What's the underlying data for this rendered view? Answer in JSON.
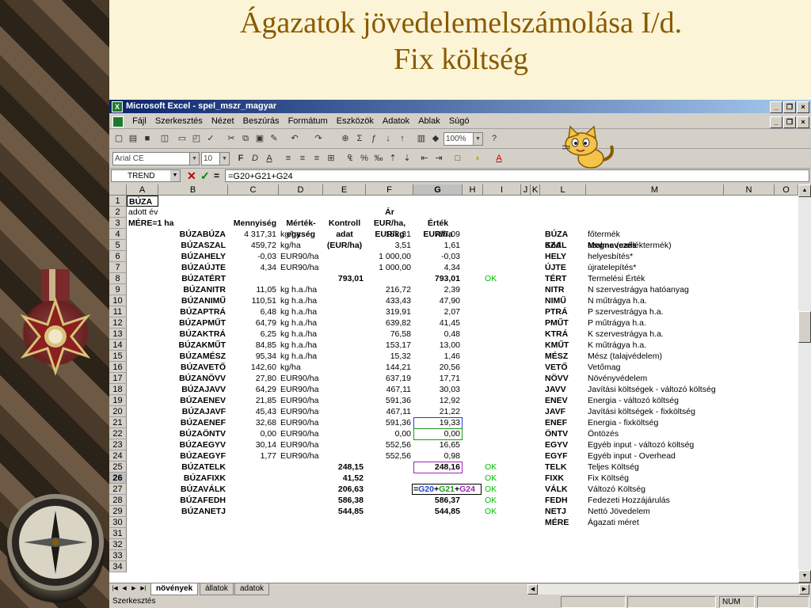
{
  "slide_title_line1": "Ágazatok jövedelemelszámolása I/d.",
  "slide_title_line2": "Fix költség",
  "window": {
    "title": "Microsoft Excel - spel_mszr_magyar",
    "buttons": [
      "_",
      "❐",
      "×"
    ],
    "doc_buttons": [
      "_",
      "❐",
      "×"
    ]
  },
  "menu": [
    "Fájl",
    "Szerkesztés",
    "Nézet",
    "Beszúrás",
    "Formátum",
    "Eszközök",
    "Adatok",
    "Ablak",
    "Súgó"
  ],
  "toolbar": {
    "zoom": "100%",
    "font": "Arial CE",
    "size": "10"
  },
  "formula_bar": {
    "name_box": "TREND",
    "formula": "=G20+G21+G24"
  },
  "columns": [
    "A",
    "B",
    "C",
    "D",
    "E",
    "F",
    "G",
    "H",
    "I",
    "J",
    "K",
    "L",
    "M",
    "N",
    "O"
  ],
  "active_column": "G",
  "rows_numbers": [
    "1",
    "2",
    "3",
    "4",
    "5",
    "6",
    "7",
    "8",
    "9",
    "10",
    "11",
    "12",
    "13",
    "14",
    "15",
    "16",
    "17",
    "18",
    "19",
    "20",
    "21",
    "22",
    "23",
    "24",
    "25",
    "26",
    "27",
    "28",
    "29",
    "30",
    "31",
    "32",
    "33",
    "34"
  ],
  "active_row": "26",
  "header": {
    "a1": "BÚZA",
    "a2": "adott év",
    "a2b": "MÉRE=1 ha",
    "c": "Mennyiség",
    "d1": "Mérték-",
    "d2": "egység",
    "e1": "Kontroll",
    "e2": "adat",
    "e3": "(EUR/ha)",
    "f1": "Ár",
    "f2": "EUR/ha,",
    "f3": "EUR/kg",
    "g1": "Érték",
    "g2": "EUR/ha",
    "l": "Kód",
    "m": "Megnevezés"
  },
  "rows": [
    {
      "b": "BÚZABÚZA",
      "c": "4 317,31",
      "d": "kg/ha",
      "e": "",
      "f": "182,31",
      "g": "787,09",
      "i": "",
      "l": "BÚZA",
      "m": "főtermék"
    },
    {
      "b": "BÚZASZAL",
      "c": "459,72",
      "d": "kg/ha",
      "e": "",
      "f": "3,51",
      "g": "1,61",
      "i": "",
      "l": "SZAL",
      "m": "szalma (melléktermék)"
    },
    {
      "b": "BÚZAHELY",
      "c": "-0,03",
      "d": "EUR90/ha",
      "e": "",
      "f": "1 000,00",
      "g": "-0,03",
      "i": "",
      "l": "HELY",
      "m": "helyesbítés*"
    },
    {
      "b": "BÚZAÚJTE",
      "c": "4,34",
      "d": "EUR90/ha",
      "e": "",
      "f": "1 000,00",
      "g": "4,34",
      "i": "",
      "l": "ÚJTE",
      "m": "újratelepítés*"
    },
    {
      "b": "BÚZATÉRT",
      "c": "",
      "d": "",
      "e": "793,01",
      "f": "",
      "g": "793,01",
      "i": "OK",
      "l": "TÉRT",
      "m": "Termelési Érték",
      "bold": true
    },
    {
      "b": "BÚZANITR",
      "c": "11,05",
      "d": "kg h.a./ha",
      "e": "",
      "f": "216,72",
      "g": "2,39",
      "i": "",
      "l": "NITR",
      "m": "N szervestrágya hatóanyag"
    },
    {
      "b": "BÚZANIMŰ",
      "c": "110,51",
      "d": "kg h.a./ha",
      "e": "",
      "f": "433,43",
      "g": "47,90",
      "i": "",
      "l": "NIMŰ",
      "m": "N műtrágya h.a."
    },
    {
      "b": "BÚZAPTRÁ",
      "c": "6,48",
      "d": "kg h.a./ha",
      "e": "",
      "f": "319,91",
      "g": "2,07",
      "i": "",
      "l": "PTRÁ",
      "m": "P szervestrágya h.a."
    },
    {
      "b": "BÚZAPMŰT",
      "c": "64,79",
      "d": "kg h.a./ha",
      "e": "",
      "f": "639,82",
      "g": "41,45",
      "i": "",
      "l": "PMŰT",
      "m": "P műtrágya h.a."
    },
    {
      "b": "BÚZAKTRÁ",
      "c": "6,25",
      "d": "kg h.a./ha",
      "e": "",
      "f": "76,58",
      "g": "0,48",
      "i": "",
      "l": "KTRÁ",
      "m": "K szervestrágya h.a."
    },
    {
      "b": "BÚZAKMŰT",
      "c": "84,85",
      "d": "kg h.a./ha",
      "e": "",
      "f": "153,17",
      "g": "13,00",
      "i": "",
      "l": "KMŰT",
      "m": "K műtrágya h.a."
    },
    {
      "b": "BÚZAMÉSZ",
      "c": "95,34",
      "d": "kg h.a./ha",
      "e": "",
      "f": "15,32",
      "g": "1,46",
      "i": "",
      "l": "MÉSZ",
      "m": "Mész (talajvédelem)"
    },
    {
      "b": "BÚZAVETŐ",
      "c": "142,60",
      "d": "kg/ha",
      "e": "",
      "f": "144,21",
      "g": "20,56",
      "i": "",
      "l": "VETŐ",
      "m": "Vetőmag"
    },
    {
      "b": "BÚZANÖVV",
      "c": "27,80",
      "d": "EUR90/ha",
      "e": "",
      "f": "637,19",
      "g": "17,71",
      "i": "",
      "l": "NÖVV",
      "m": "Növényvédelem"
    },
    {
      "b": "BÚZAJAVV",
      "c": "64,29",
      "d": "EUR90/ha",
      "e": "",
      "f": "467,11",
      "g": "30,03",
      "i": "",
      "l": "JAVV",
      "m": "Javítási költségek - változó költség"
    },
    {
      "b": "BÚZAENEV",
      "c": "21,85",
      "d": "EUR90/ha",
      "e": "",
      "f": "591,36",
      "g": "12,92",
      "i": "",
      "l": "ENEV",
      "m": "Energia - változó költség"
    },
    {
      "b": "BÚZAJAVF",
      "c": "45,43",
      "d": "EUR90/ha",
      "e": "",
      "f": "467,11",
      "g": "21,22",
      "i": "",
      "l": "JAVF",
      "m": "Javítási költségek - fixköltség"
    },
    {
      "b": "BÚZAENEF",
      "c": "32,68",
      "d": "EUR90/ha",
      "e": "",
      "f": "591,36",
      "g": "19,33",
      "i": "",
      "l": "ENEF",
      "m": "Energia - fixköltség"
    },
    {
      "b": "BÚZAÖNTV",
      "c": "0,00",
      "d": "EUR90/ha",
      "e": "",
      "f": "0,00",
      "g": "0,00",
      "i": "",
      "l": "ÖNTV",
      "m": "Öntözés"
    },
    {
      "b": "BÚZAEGYV",
      "c": "30,14",
      "d": "EUR90/ha",
      "e": "",
      "f": "552,56",
      "g": "16,65",
      "i": "",
      "l": "EGYV",
      "m": "Egyéb input - változó költség"
    },
    {
      "b": "BÚZAEGYF",
      "c": "1,77",
      "d": "EUR90/ha",
      "e": "",
      "f": "552,56",
      "g": "0,98",
      "i": "",
      "l": "EGYF",
      "m": "Egyéb input - Overhead"
    },
    {
      "b": "BÚZATELK",
      "c": "",
      "d": "",
      "e": "248,15",
      "f": "",
      "g": "248,16",
      "i": "OK",
      "l": "TELK",
      "m": "Teljes Költség",
      "bold": true
    },
    {
      "b": "BÚZAFIXK",
      "c": "",
      "d": "",
      "e": "41,52",
      "f": "",
      "g": "",
      "i": "OK",
      "l": "FIXK",
      "m": "Fix Költség",
      "bold": true
    },
    {
      "b": "BÚZAVÁLK",
      "c": "",
      "d": "",
      "e": "206,63",
      "f": "",
      "g": "206,64",
      "i": "OK",
      "l": "VÁLK",
      "m": "Változó Költség",
      "bold": true
    },
    {
      "b": "BÚZAFEDH",
      "c": "",
      "d": "",
      "e": "586,38",
      "f": "",
      "g": "586,37",
      "i": "OK",
      "l": "FEDH",
      "m": "Fedezeti Hozzájárulás",
      "bold": true
    },
    {
      "b": "BÚZANETJ",
      "c": "",
      "d": "",
      "e": "544,85",
      "f": "",
      "g": "544,85",
      "i": "OK",
      "l": "NETJ",
      "m": "Nettó Jövedelem",
      "bold": true
    },
    {
      "b": "",
      "c": "",
      "d": "",
      "e": "",
      "f": "",
      "g": "",
      "i": "",
      "l": "MÉRE",
      "m": "Ágazati méret"
    }
  ],
  "edit_cell": {
    "eq": "=",
    "p1": "G20",
    "plus1": "+",
    "p2": "G21",
    "plus2": "+",
    "p3": "G24"
  },
  "sheet_tabs": [
    "növények",
    "állatok",
    "adatok"
  ],
  "active_tab": "növények",
  "status": {
    "mode": "Szerkesztés",
    "num": "NUM"
  },
  "colors": {
    "ref1": "#1f3fcf",
    "ref2": "#1a9a1a",
    "ref3": "#a020c0",
    "title": "#8a5a00",
    "ok": "#00c000"
  }
}
